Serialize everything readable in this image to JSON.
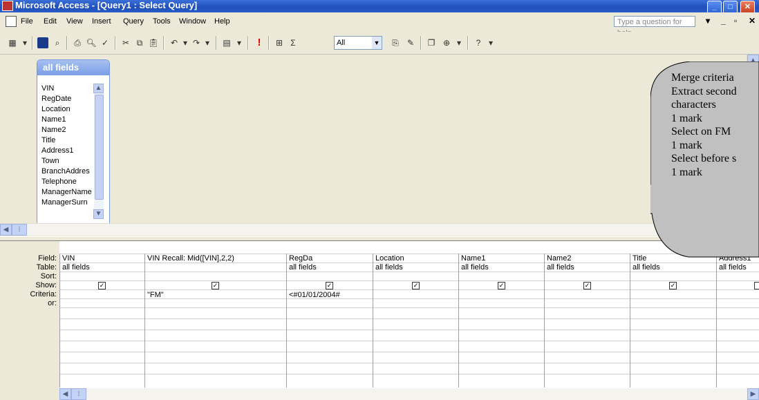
{
  "window": {
    "title": "Microsoft Access - [Query1 : Select Query]"
  },
  "menu": {
    "items": [
      "File",
      "Edit",
      "View",
      "Insert",
      "Query",
      "Tools",
      "Window",
      "Help"
    ],
    "help_placeholder": "Type a question for help"
  },
  "toolbar": {
    "top_values": "All",
    "sigma": "Σ",
    "run": "!"
  },
  "field_list": {
    "title": "all fields",
    "fields": [
      "VIN",
      "RegDate",
      "Location",
      "Name1",
      "Name2",
      "Title",
      "Address1",
      "Town",
      "BranchAddres",
      "Telephone",
      "ManagerName",
      "ManagerSurn"
    ]
  },
  "grid": {
    "row_labels": [
      "Field:",
      "Table:",
      "Sort:",
      "Show:",
      "Criteria:",
      "or:"
    ],
    "columns": [
      {
        "field": "VIN",
        "table": "all fields",
        "show": true,
        "criteria": ""
      },
      {
        "field": "VIN Recall: Mid([VIN],2,2)",
        "table": "",
        "show": true,
        "criteria": "\"FM\""
      },
      {
        "field": "RegDa",
        "table": "all fields",
        "show": true,
        "criteria": "<#01/01/2004#"
      },
      {
        "field": "Location",
        "table": "all fields",
        "show": true,
        "criteria": ""
      },
      {
        "field": "Name1",
        "table": "all fields",
        "show": true,
        "criteria": ""
      },
      {
        "field": "Name2",
        "table": "all fields",
        "show": true,
        "criteria": ""
      },
      {
        "field": "Title",
        "table": "all fields",
        "show": true,
        "criteria": ""
      },
      {
        "field": "Address1",
        "table": "all fields",
        "show": true,
        "criteria": ""
      }
    ]
  },
  "callout": {
    "lines": [
      "Merge criteria",
      "Extract second",
      "characters",
      "1 mark",
      "Select on FM",
      "1 mark",
      "Select before s",
      "1 mark"
    ]
  }
}
